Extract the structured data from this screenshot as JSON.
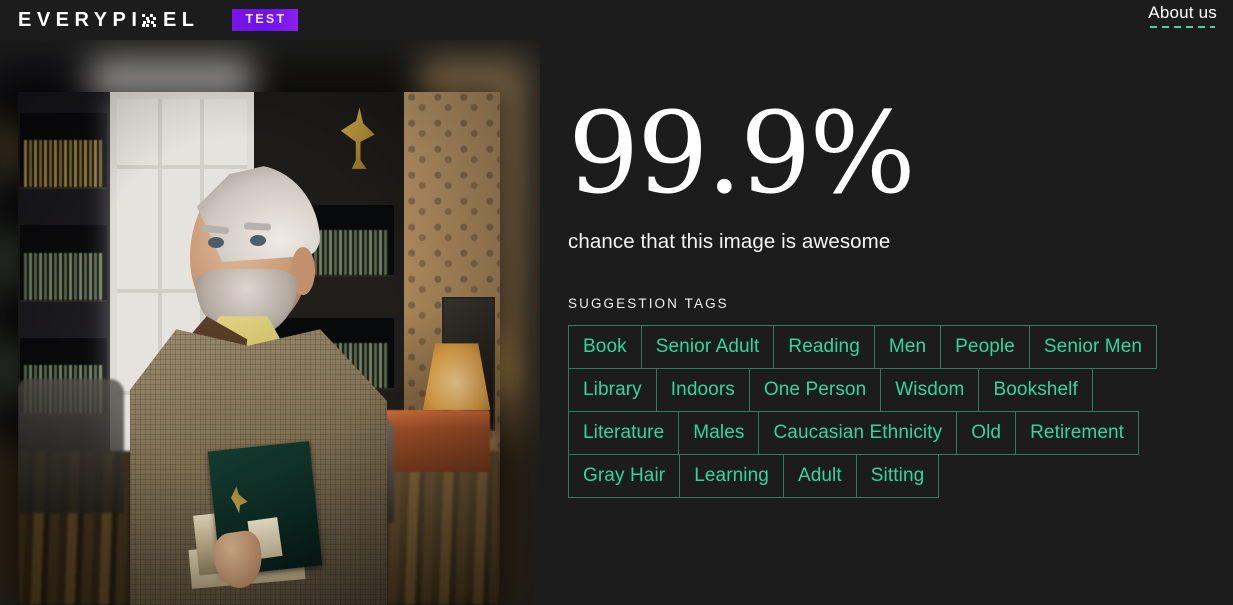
{
  "header": {
    "logo_text_1": "EVERYPI",
    "logo_text_2": "EL",
    "logo_icon": "pixelated-x-icon",
    "badge_label": "TEST",
    "about_label": "About us"
  },
  "photo": {
    "alt": "elderly man with gray hair holding books in a library",
    "caption": ""
  },
  "result": {
    "score": "99.9%",
    "score_caption": "chance that this image is awesome"
  },
  "tags_section": {
    "heading": "SUGGESTION TAGS",
    "tags": [
      "Book",
      "Senior Adult",
      "Reading",
      "Men",
      "People",
      "Senior Men",
      "Library",
      "Indoors",
      "One Person",
      "Wisdom",
      "Bookshelf",
      "Literature",
      "Males",
      "Caucasian Ethnicity",
      "Old",
      "Retirement",
      "Gray Hair",
      "Learning",
      "Adult",
      "Sitting"
    ]
  },
  "colors": {
    "background": "#1c1c1c",
    "accent_tag": "#2fd79f",
    "tag_border": "#2f7a63",
    "badge_bg": "#7a14e8",
    "text": "#ffffff"
  }
}
